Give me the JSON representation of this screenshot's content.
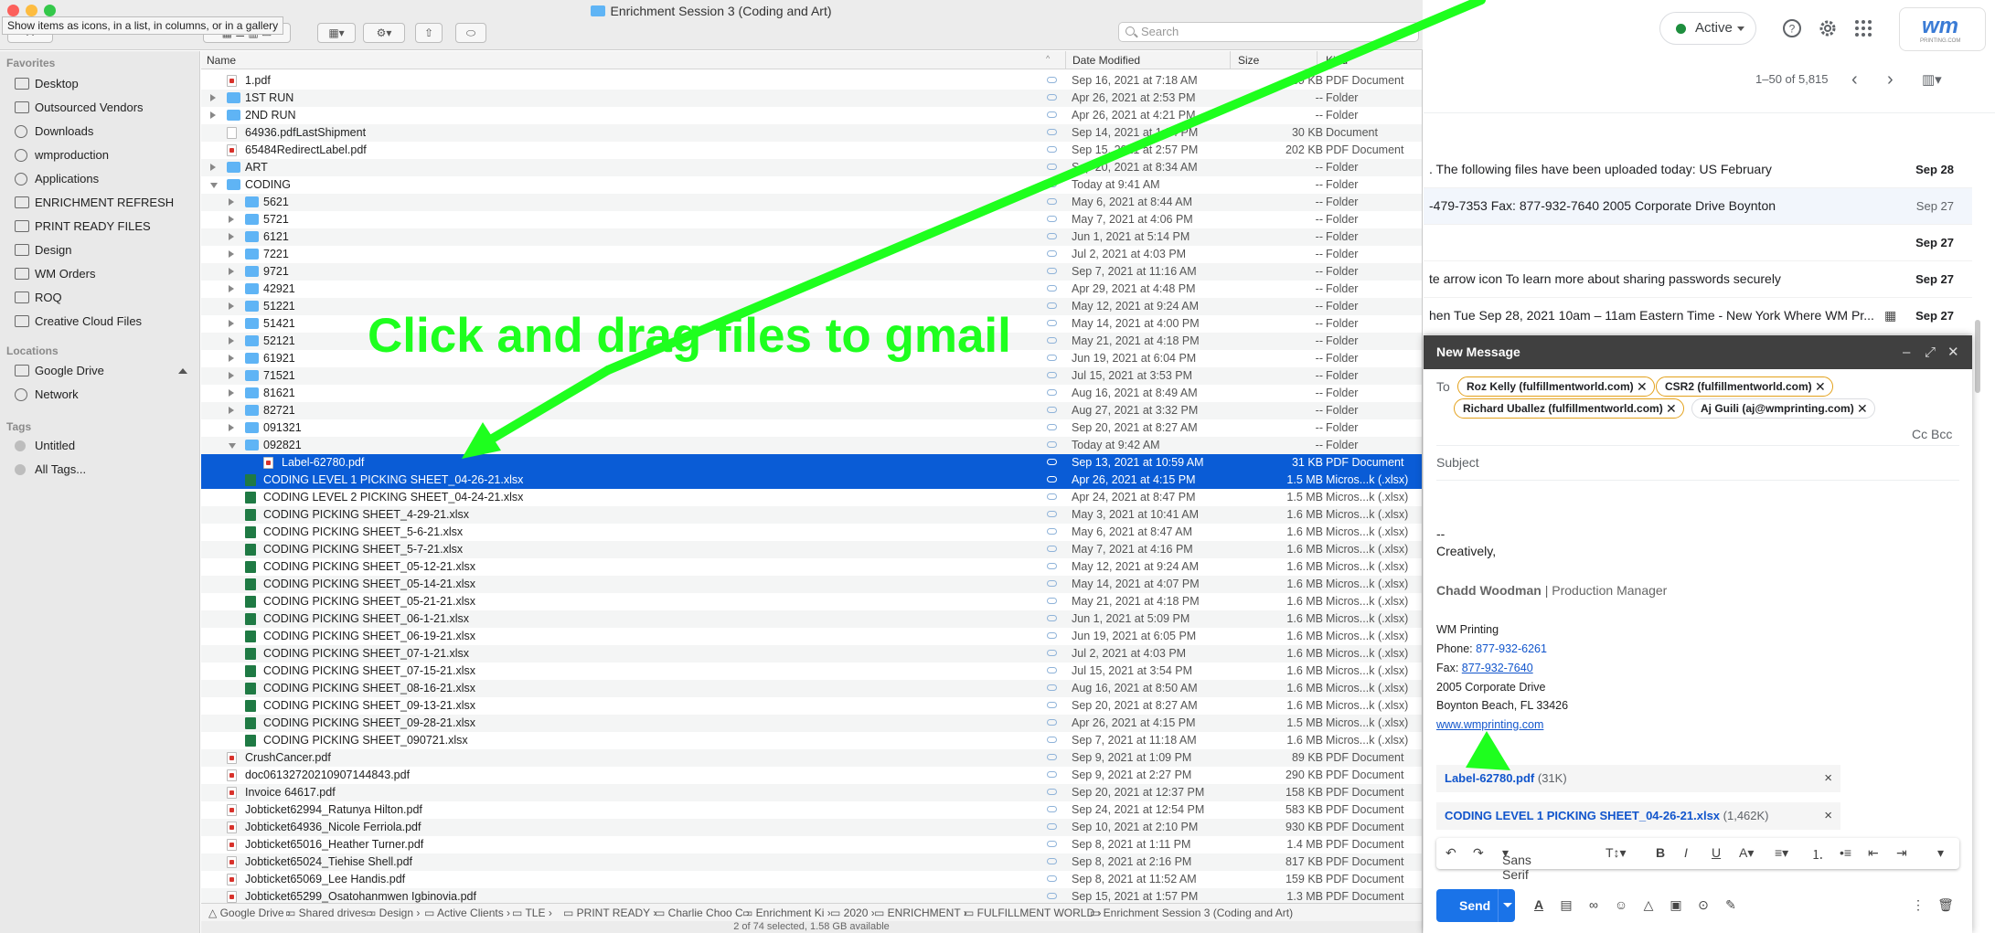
{
  "finder": {
    "window_title": "Enrichment Session 3 (Coding and Art)",
    "tooltip": "Show items as icons, in a list, in columns, or in a gallery",
    "search_placeholder": "Search",
    "columns": {
      "name": "Name",
      "date": "Date Modified",
      "size": "Size",
      "kind": "Kind"
    },
    "sidebar": {
      "favorites_heading": "Favorites",
      "favorites": [
        "Desktop",
        "Outsourced Vendors",
        "Downloads",
        "wmproduction",
        "Applications",
        "ENRICHMENT REFRESH",
        "PRINT READY FILES",
        "Design",
        "WM Orders",
        "ROQ",
        "Creative Cloud Files"
      ],
      "locations_heading": "Locations",
      "locations": [
        "Google Drive",
        "Network"
      ],
      "tags_heading": "Tags",
      "tags": [
        "Untitled",
        "All Tags..."
      ]
    },
    "rows": [
      {
        "name": "1.pdf",
        "date": "Sep 16, 2021 at 7:18 AM",
        "size": "39 KB",
        "kind": "PDF Document",
        "icon": "pdf",
        "level": 0
      },
      {
        "name": "1ST RUN",
        "date": "Apr 26, 2021 at 2:53 PM",
        "size": "--",
        "kind": "Folder",
        "icon": "folder",
        "level": 0,
        "disclosure": "closed"
      },
      {
        "name": "2ND RUN",
        "date": "Apr 26, 2021 at 4:21 PM",
        "size": "--",
        "kind": "Folder",
        "icon": "folder",
        "level": 0,
        "disclosure": "closed"
      },
      {
        "name": "64936.pdfLastShipment",
        "date": "Sep 14, 2021 at 1:04 PM",
        "size": "30 KB",
        "kind": "Document",
        "icon": "doc",
        "level": 0
      },
      {
        "name": "65484RedirectLabel.pdf",
        "date": "Sep 15, 2021 at 2:57 PM",
        "size": "202 KB",
        "kind": "PDF Document",
        "icon": "pdf",
        "level": 0
      },
      {
        "name": "ART",
        "date": "Sep 20, 2021 at 8:34 AM",
        "size": "--",
        "kind": "Folder",
        "icon": "folder",
        "level": 0,
        "disclosure": "closed"
      },
      {
        "name": "CODING",
        "date": "Today at 9:41 AM",
        "size": "--",
        "kind": "Folder",
        "icon": "folder",
        "level": 0,
        "disclosure": "open"
      },
      {
        "name": "5621",
        "date": "May 6, 2021 at 8:44 AM",
        "size": "--",
        "kind": "Folder",
        "icon": "folder",
        "level": 1,
        "disclosure": "closed"
      },
      {
        "name": "5721",
        "date": "May 7, 2021 at 4:06 PM",
        "size": "--",
        "kind": "Folder",
        "icon": "folder",
        "level": 1,
        "disclosure": "closed"
      },
      {
        "name": "6121",
        "date": "Jun 1, 2021 at 5:14 PM",
        "size": "--",
        "kind": "Folder",
        "icon": "folder",
        "level": 1,
        "disclosure": "closed"
      },
      {
        "name": "7221",
        "date": "Jul 2, 2021 at 4:03 PM",
        "size": "--",
        "kind": "Folder",
        "icon": "folder",
        "level": 1,
        "disclosure": "closed"
      },
      {
        "name": "9721",
        "date": "Sep 7, 2021 at 11:16 AM",
        "size": "--",
        "kind": "Folder",
        "icon": "folder",
        "level": 1,
        "disclosure": "closed"
      },
      {
        "name": "42921",
        "date": "Apr 29, 2021 at 4:48 PM",
        "size": "--",
        "kind": "Folder",
        "icon": "folder",
        "level": 1,
        "disclosure": "closed"
      },
      {
        "name": "51221",
        "date": "May 12, 2021 at 9:24 AM",
        "size": "--",
        "kind": "Folder",
        "icon": "folder",
        "level": 1,
        "disclosure": "closed"
      },
      {
        "name": "51421",
        "date": "May 14, 2021 at 4:00 PM",
        "size": "--",
        "kind": "Folder",
        "icon": "folder",
        "level": 1,
        "disclosure": "closed"
      },
      {
        "name": "52121",
        "date": "May 21, 2021 at 4:18 PM",
        "size": "--",
        "kind": "Folder",
        "icon": "folder",
        "level": 1,
        "disclosure": "closed"
      },
      {
        "name": "61921",
        "date": "Jun 19, 2021 at 6:04 PM",
        "size": "--",
        "kind": "Folder",
        "icon": "folder",
        "level": 1,
        "disclosure": "closed"
      },
      {
        "name": "71521",
        "date": "Jul 15, 2021 at 3:53 PM",
        "size": "--",
        "kind": "Folder",
        "icon": "folder",
        "level": 1,
        "disclosure": "closed"
      },
      {
        "name": "81621",
        "date": "Aug 16, 2021 at 8:49 AM",
        "size": "--",
        "kind": "Folder",
        "icon": "folder",
        "level": 1,
        "disclosure": "closed"
      },
      {
        "name": "82721",
        "date": "Aug 27, 2021 at 3:32 PM",
        "size": "--",
        "kind": "Folder",
        "icon": "folder",
        "level": 1,
        "disclosure": "closed"
      },
      {
        "name": "091321",
        "date": "Sep 20, 2021 at 8:27 AM",
        "size": "--",
        "kind": "Folder",
        "icon": "folder",
        "level": 1,
        "disclosure": "closed"
      },
      {
        "name": "092821",
        "date": "Today at 9:42 AM",
        "size": "--",
        "kind": "Folder",
        "icon": "folder",
        "level": 1,
        "disclosure": "open"
      },
      {
        "name": "Label-62780.pdf",
        "date": "Sep 13, 2021 at 10:59 AM",
        "size": "31 KB",
        "kind": "PDF Document",
        "icon": "pdf",
        "level": 2,
        "selected": true
      },
      {
        "name": "CODING LEVEL 1 PICKING SHEET_04-26-21.xlsx",
        "date": "Apr 26, 2021 at 4:15 PM",
        "size": "1.5 MB",
        "kind": "Micros...k (.xlsx)",
        "icon": "xls",
        "level": 1,
        "selected": true
      },
      {
        "name": "CODING LEVEL 2 PICKING SHEET_04-24-21.xlsx",
        "date": "Apr 24, 2021 at 8:47 PM",
        "size": "1.5 MB",
        "kind": "Micros...k (.xlsx)",
        "icon": "xls",
        "level": 1
      },
      {
        "name": "CODING PICKING SHEET_4-29-21.xlsx",
        "date": "May 3, 2021 at 10:41 AM",
        "size": "1.6 MB",
        "kind": "Micros...k (.xlsx)",
        "icon": "xls",
        "level": 1
      },
      {
        "name": "CODING PICKING SHEET_5-6-21.xlsx",
        "date": "May 6, 2021 at 8:47 AM",
        "size": "1.6 MB",
        "kind": "Micros...k (.xlsx)",
        "icon": "xls",
        "level": 1
      },
      {
        "name": "CODING PICKING SHEET_5-7-21.xlsx",
        "date": "May 7, 2021 at 4:16 PM",
        "size": "1.6 MB",
        "kind": "Micros...k (.xlsx)",
        "icon": "xls",
        "level": 1
      },
      {
        "name": "CODING PICKING SHEET_05-12-21.xlsx",
        "date": "May 12, 2021 at 9:24 AM",
        "size": "1.6 MB",
        "kind": "Micros...k (.xlsx)",
        "icon": "xls",
        "level": 1
      },
      {
        "name": "CODING PICKING SHEET_05-14-21.xlsx",
        "date": "May 14, 2021 at 4:07 PM",
        "size": "1.6 MB",
        "kind": "Micros...k (.xlsx)",
        "icon": "xls",
        "level": 1
      },
      {
        "name": "CODING PICKING SHEET_05-21-21.xlsx",
        "date": "May 21, 2021 at 4:18 PM",
        "size": "1.6 MB",
        "kind": "Micros...k (.xlsx)",
        "icon": "xls",
        "level": 1
      },
      {
        "name": "CODING PICKING SHEET_06-1-21.xlsx",
        "date": "Jun 1, 2021 at 5:09 PM",
        "size": "1.6 MB",
        "kind": "Micros...k (.xlsx)",
        "icon": "xls",
        "level": 1
      },
      {
        "name": "CODING PICKING SHEET_06-19-21.xlsx",
        "date": "Jun 19, 2021 at 6:05 PM",
        "size": "1.6 MB",
        "kind": "Micros...k (.xlsx)",
        "icon": "xls",
        "level": 1
      },
      {
        "name": "CODING PICKING SHEET_07-1-21.xlsx",
        "date": "Jul 2, 2021 at 4:03 PM",
        "size": "1.6 MB",
        "kind": "Micros...k (.xlsx)",
        "icon": "xls",
        "level": 1
      },
      {
        "name": "CODING PICKING SHEET_07-15-21.xlsx",
        "date": "Jul 15, 2021 at 3:54 PM",
        "size": "1.6 MB",
        "kind": "Micros...k (.xlsx)",
        "icon": "xls",
        "level": 1
      },
      {
        "name": "CODING PICKING SHEET_08-16-21.xlsx",
        "date": "Aug 16, 2021 at 8:50 AM",
        "size": "1.6 MB",
        "kind": "Micros...k (.xlsx)",
        "icon": "xls",
        "level": 1
      },
      {
        "name": "CODING PICKING SHEET_09-13-21.xlsx",
        "date": "Sep 20, 2021 at 8:27 AM",
        "size": "1.6 MB",
        "kind": "Micros...k (.xlsx)",
        "icon": "xls",
        "level": 1
      },
      {
        "name": "CODING PICKING SHEET_09-28-21.xlsx",
        "date": "Apr 26, 2021 at 4:15 PM",
        "size": "1.5 MB",
        "kind": "Micros...k (.xlsx)",
        "icon": "xls",
        "level": 1
      },
      {
        "name": "CODING PICKING SHEET_090721.xlsx",
        "date": "Sep 7, 2021 at 11:18 AM",
        "size": "1.6 MB",
        "kind": "Micros...k (.xlsx)",
        "icon": "xls",
        "level": 1
      },
      {
        "name": "CrushCancer.pdf",
        "date": "Sep 9, 2021 at 1:09 PM",
        "size": "89 KB",
        "kind": "PDF Document",
        "icon": "pdf",
        "level": 0
      },
      {
        "name": "doc06132720210907144843.pdf",
        "date": "Sep 9, 2021 at 2:27 PM",
        "size": "290 KB",
        "kind": "PDF Document",
        "icon": "pdf",
        "level": 0
      },
      {
        "name": "Invoice 64617.pdf",
        "date": "Sep 20, 2021 at 12:37 PM",
        "size": "158 KB",
        "kind": "PDF Document",
        "icon": "pdf",
        "level": 0
      },
      {
        "name": "Jobticket62994_Ratunya Hilton.pdf",
        "date": "Sep 24, 2021 at 12:54 PM",
        "size": "583 KB",
        "kind": "PDF Document",
        "icon": "pdf",
        "level": 0
      },
      {
        "name": "Jobticket64936_Nicole Ferriola.pdf",
        "date": "Sep 10, 2021 at 2:10 PM",
        "size": "930 KB",
        "kind": "PDF Document",
        "icon": "pdf",
        "level": 0
      },
      {
        "name": "Jobticket65016_Heather Turner.pdf",
        "date": "Sep 8, 2021 at 1:11 PM",
        "size": "1.4 MB",
        "kind": "PDF Document",
        "icon": "pdf",
        "level": 0
      },
      {
        "name": "Jobticket65024_Tiehise Shell.pdf",
        "date": "Sep 8, 2021 at 2:16 PM",
        "size": "817 KB",
        "kind": "PDF Document",
        "icon": "pdf",
        "level": 0
      },
      {
        "name": "Jobticket65069_Lee Handis.pdf",
        "date": "Sep 8, 2021 at 11:52 AM",
        "size": "159 KB",
        "kind": "PDF Document",
        "icon": "pdf",
        "level": 0
      },
      {
        "name": "Jobticket65299_Osatohanmwen Igbinovia.pdf",
        "date": "Sep 15, 2021 at 1:57 PM",
        "size": "1.3 MB",
        "kind": "PDF Document",
        "icon": "pdf",
        "level": 0
      }
    ],
    "pathbar": [
      "Google Drive",
      "Shared drives",
      "Design",
      "Active Clients",
      "TLE",
      "PRINT READY",
      "Charlie Choo C",
      "Enrichment Ki",
      "2020",
      "ENRICHMENT",
      "FULFILLMENT WORLD",
      "Enrichment Session 3 (Coding and Art)"
    ],
    "status": "2 of 74 selected, 1.58 GB available"
  },
  "gmail": {
    "status_label": "Active",
    "brand_sub": "PRINTING.COM",
    "brand_mark": "wm",
    "pagination": "1–50 of 5,815",
    "emails": [
      {
        "snippet": ". The following files have been uploaded today: US February",
        "date": "Sep 28",
        "bold": true
      },
      {
        "snippet": "-479-7353 Fax: 877-932-7640 2005 Corporate Drive Boynton",
        "date": "Sep 27",
        "bold": false
      },
      {
        "snippet": "",
        "date": "Sep 27",
        "bold": true
      },
      {
        "snippet": "te arrow icon To learn more about sharing passwords securely",
        "date": "Sep 27",
        "bold": true
      },
      {
        "snippet": "hen Tue Sep 28, 2021 10am – 11am Eastern Time - New York Where WM Pr...",
        "date": "Sep 27",
        "bold": true
      }
    ],
    "compose": {
      "title": "New Message",
      "to_label": "To",
      "recipients": [
        "Roz Kelly (fulfillmentworld.com)",
        "CSR2 (fulfillmentworld.com)",
        "Richard Uballez (fulfillmentworld.com)",
        "Aj Guili (aj@wmprinting.com)"
      ],
      "cc_bcc": "Cc Bcc",
      "subject_placeholder": "Subject",
      "signature": {
        "dash": "--",
        "closing": "Creatively,",
        "name": "Chadd Woodman",
        "title": " | Production Manager",
        "company": "WM Printing",
        "phone_label": "Phone: ",
        "phone": "877-932-6261",
        "fax_label": "Fax: ",
        "fax": "877-932-7640",
        "address1": "2005 Corporate Drive",
        "address2": "Boynton Beach, FL 33426",
        "website": "www.wmprinting.com"
      },
      "attachments": [
        {
          "name": "Label-62780.pdf",
          "size": " (31K)"
        },
        {
          "name": "CODING LEVEL 1 PICKING SHEET_04-26-21.xlsx",
          "size": " (1,462K)"
        }
      ],
      "font_label": "Sans Serif",
      "send_label": "Send"
    }
  },
  "annotation": {
    "text": "Click and drag files to gmail",
    "color": "#1eff1e"
  }
}
